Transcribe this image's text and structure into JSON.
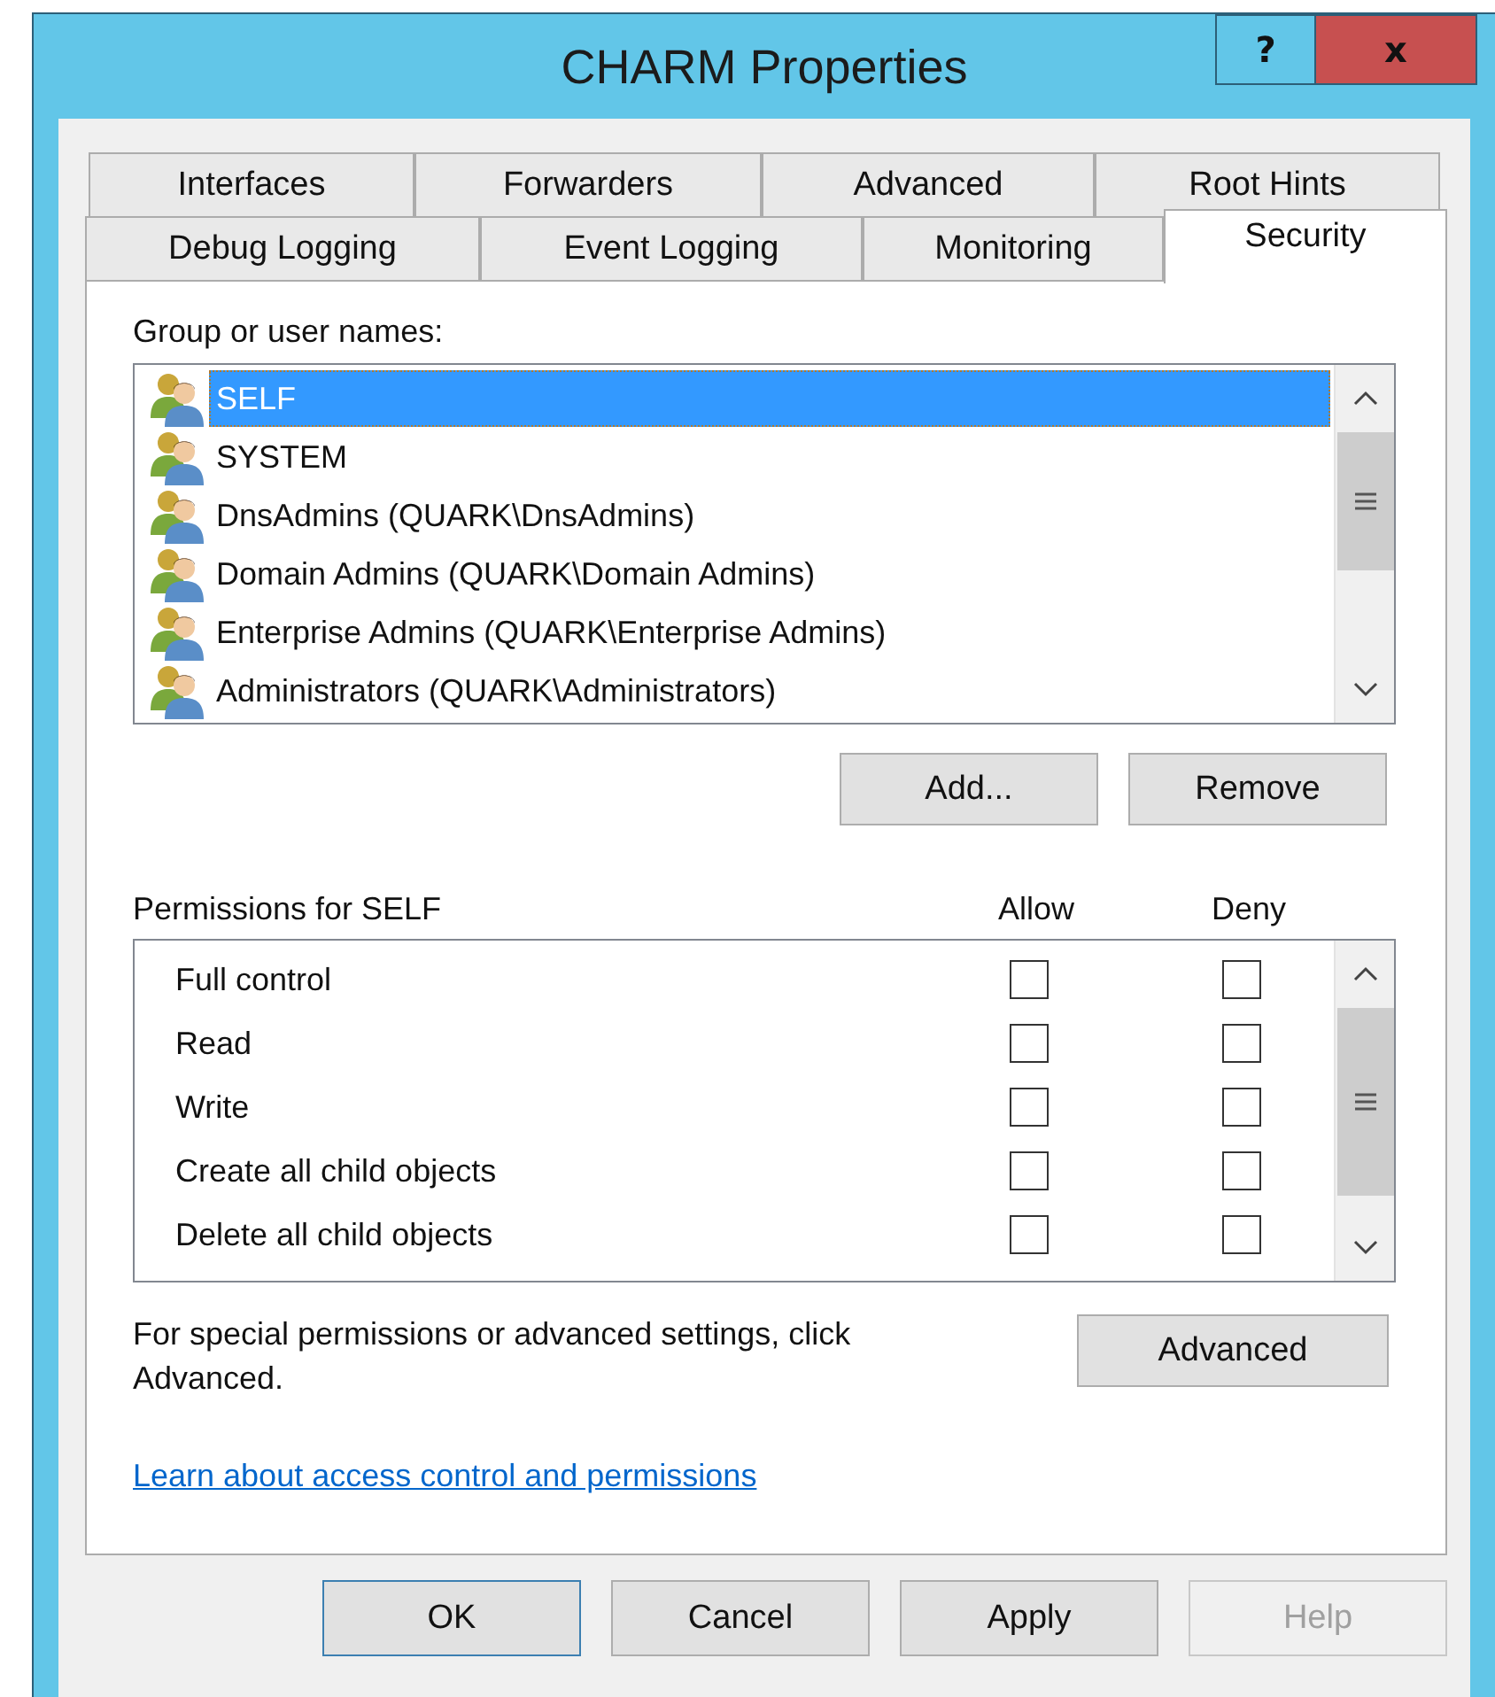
{
  "window": {
    "title": "CHARM Properties",
    "title_buttons": [
      {
        "kind": "help",
        "label": "?"
      },
      {
        "kind": "close",
        "label": "x"
      }
    ]
  },
  "tab_rows": [
    {
      "tabs": [
        {
          "label": "Interfaces",
          "selected": false
        },
        {
          "label": "Forwarders",
          "selected": false
        },
        {
          "label": "Advanced",
          "selected": false
        },
        {
          "label": "Root Hints",
          "selected": false
        }
      ]
    },
    {
      "tabs": [
        {
          "label": "Debug Logging",
          "selected": false
        },
        {
          "label": "Event Logging",
          "selected": false
        },
        {
          "label": "Monitoring",
          "selected": false
        },
        {
          "label": "Security",
          "selected": true
        }
      ]
    }
  ],
  "security": {
    "group_label": "Group or user names:",
    "principals": [
      {
        "name": "SELF",
        "selected": true
      },
      {
        "name": "SYSTEM",
        "selected": false
      },
      {
        "name": "DnsAdmins (QUARK\\DnsAdmins)",
        "selected": false
      },
      {
        "name": "Domain Admins (QUARK\\Domain Admins)",
        "selected": false
      },
      {
        "name": "Enterprise Admins (QUARK\\Enterprise Admins)",
        "selected": false
      },
      {
        "name": "Administrators (QUARK\\Administrators)",
        "selected": false
      }
    ],
    "principal_buttons": [
      {
        "label": "Add..."
      },
      {
        "label": "Remove"
      }
    ],
    "permissions_label": "Permissions for SELF",
    "allow_header": "Allow",
    "deny_header": "Deny",
    "permissions": [
      {
        "name": "Full control",
        "allow": false,
        "deny": false
      },
      {
        "name": "Read",
        "allow": false,
        "deny": false
      },
      {
        "name": "Write",
        "allow": false,
        "deny": false
      },
      {
        "name": "Create all child objects",
        "allow": false,
        "deny": false
      },
      {
        "name": "Delete all child objects",
        "allow": false,
        "deny": false
      }
    ],
    "advanced_note": "For special permissions or advanced settings, click Advanced.",
    "advanced_button": "Advanced",
    "link": "Learn about access control and permissions"
  },
  "buttons": [
    {
      "label": "OK",
      "default": true,
      "disabled": false
    },
    {
      "label": "Cancel",
      "default": false,
      "disabled": false
    },
    {
      "label": "Apply",
      "default": false,
      "disabled": false
    },
    {
      "label": "Help",
      "default": false,
      "disabled": true
    }
  ]
}
